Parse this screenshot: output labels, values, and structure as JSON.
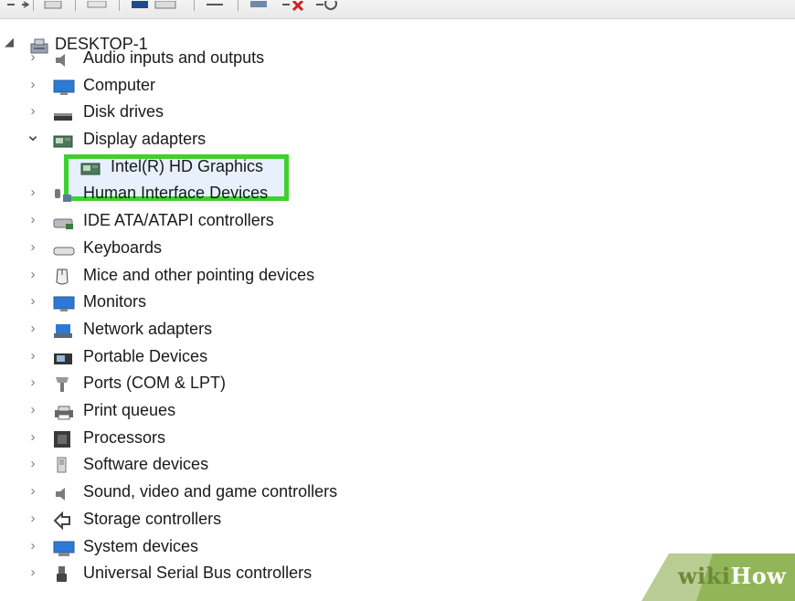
{
  "root": {
    "label": "DESKTOP-1",
    "icon": "computer-tower-icon"
  },
  "categories": [
    {
      "label": "Audio inputs and outputs",
      "icon": "speaker-icon",
      "expanded": false
    },
    {
      "label": "Computer",
      "icon": "monitor-icon",
      "expanded": false
    },
    {
      "label": "Disk drives",
      "icon": "disk-drive-icon",
      "expanded": false
    },
    {
      "label": "Display adapters",
      "icon": "display-adapter-icon",
      "expanded": true
    },
    {
      "label": "Human Interface Devices",
      "icon": "hid-icon",
      "expanded": false
    },
    {
      "label": "IDE ATA/ATAPI controllers",
      "icon": "ide-controller-icon",
      "expanded": false
    },
    {
      "label": "Keyboards",
      "icon": "keyboard-icon",
      "expanded": false
    },
    {
      "label": "Mice and other pointing devices",
      "icon": "mouse-icon",
      "expanded": false
    },
    {
      "label": "Monitors",
      "icon": "monitor-icon",
      "expanded": false
    },
    {
      "label": "Network adapters",
      "icon": "network-adapter-icon",
      "expanded": false
    },
    {
      "label": "Portable Devices",
      "icon": "portable-device-icon",
      "expanded": false
    },
    {
      "label": "Ports (COM & LPT)",
      "icon": "port-icon",
      "expanded": false
    },
    {
      "label": "Print queues",
      "icon": "printer-icon",
      "expanded": false
    },
    {
      "label": "Processors",
      "icon": "processor-icon",
      "expanded": false
    },
    {
      "label": "Software devices",
      "icon": "software-device-icon",
      "expanded": false
    },
    {
      "label": "Sound, video and game controllers",
      "icon": "sound-icon",
      "expanded": false
    },
    {
      "label": "Storage controllers",
      "icon": "storage-controller-icon",
      "expanded": false
    },
    {
      "label": "System devices",
      "icon": "system-device-icon",
      "expanded": false
    },
    {
      "label": "Universal Serial Bus controllers",
      "icon": "usb-icon",
      "expanded": false
    }
  ],
  "display_adapter_child": {
    "label": "Intel(R) HD Graphics",
    "icon": "display-adapter-icon",
    "selected": true
  },
  "highlight_color": "#3ed12d",
  "watermark": {
    "wiki": "wiki",
    "how": "How"
  }
}
